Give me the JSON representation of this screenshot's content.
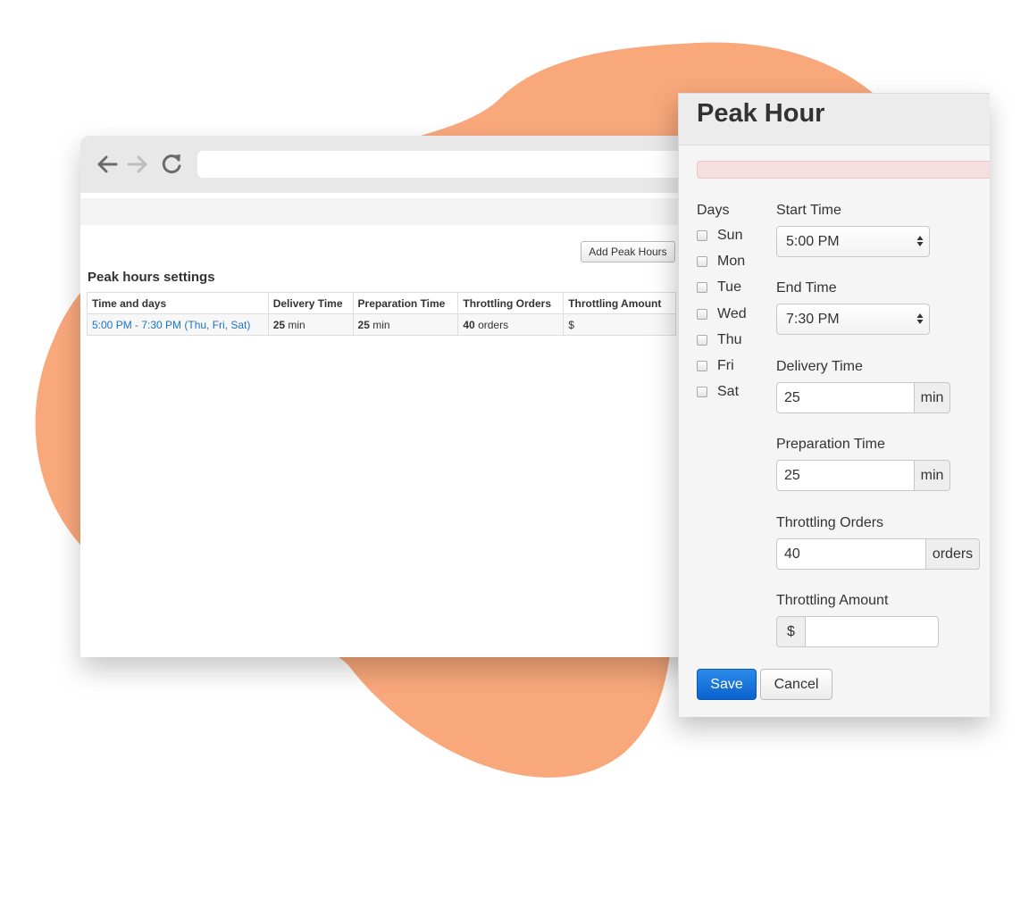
{
  "colors": {
    "blob": "#f9a87b",
    "link": "#1a73c8",
    "primary": "#0b62cf",
    "alert_bg": "#f4dede"
  },
  "browser": {
    "icons": [
      "back-arrow-icon",
      "forward-arrow-icon",
      "reload-icon"
    ],
    "address_value": "",
    "add_button_label": "Add Peak Hours",
    "section_title": "Peak hours settings",
    "table": {
      "headers": [
        "Time and days",
        "Delivery Time",
        "Preparation Time",
        "Throttling Orders",
        "Throttling Amount"
      ],
      "row": {
        "time_days": "5:00 PM - 7:30 PM (Thu, Fri, Sat)",
        "delivery_value": "25",
        "delivery_unit": "min",
        "prep_value": "25",
        "prep_unit": "min",
        "orders_value": "40",
        "orders_unit": "orders",
        "amount_prefix": "$"
      }
    }
  },
  "modal": {
    "title": "Peak Hour",
    "days_label": "Days",
    "days": [
      "Sun",
      "Mon",
      "Tue",
      "Wed",
      "Thu",
      "Fri",
      "Sat"
    ],
    "start_time_label": "Start Time",
    "start_time_value": "5:00 PM",
    "end_time_label": "End Time",
    "end_time_value": "7:30 PM",
    "delivery_label": "Delivery Time",
    "delivery_value": "25",
    "delivery_unit": "min",
    "prep_label": "Preparation Time",
    "prep_value": "25",
    "prep_unit": "min",
    "orders_label": "Throttling Orders",
    "orders_value": "40",
    "orders_unit": "orders",
    "amount_label": "Throttling Amount",
    "amount_prefix": "$",
    "amount_value": "",
    "save_label": "Save",
    "cancel_label": "Cancel"
  }
}
